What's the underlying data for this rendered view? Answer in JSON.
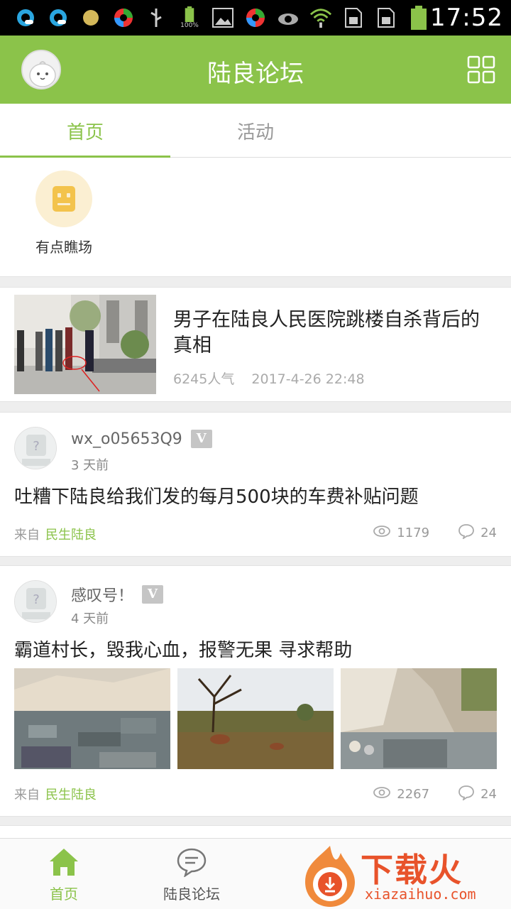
{
  "status_bar": {
    "time": "17:52",
    "battery_label": "100%",
    "icons": [
      "browser-icon",
      "browser-icon",
      "dot-icon",
      "app-icon",
      "usb-icon",
      "battery-icon",
      "image-icon",
      "app-icon",
      "eye-icon",
      "wifi-icon",
      "sim-icon",
      "sim-icon",
      "battery-icon"
    ]
  },
  "header": {
    "title": "陆良论坛",
    "avatar_icon": "avatar-icon",
    "menu_icon": "grid-icon"
  },
  "tabs": [
    {
      "label": "首页",
      "active": true
    },
    {
      "label": "活动",
      "active": false
    }
  ],
  "quick": {
    "items": [
      {
        "label": "有点瞧场",
        "icon": "face-icon"
      }
    ]
  },
  "news": {
    "title": "男子在陆良人民医院跳楼自杀背后的真相",
    "views": "6245人气",
    "date": "2017-4-26 22:48"
  },
  "posts": [
    {
      "user": "wx_o05653Q9",
      "badge": "V",
      "time": "3 天前",
      "title": "吐糟下陆良给我们发的每月500块的车费补贴问题",
      "from_label": "来自",
      "source": "民生陆良",
      "views": "1179",
      "comments": "24"
    },
    {
      "user": "感叹号！",
      "badge": "V",
      "time": "4 天前",
      "title": "霸道村长，毁我心血，报警无果 寻求帮助",
      "from_label": "来自",
      "source": "民生陆良",
      "views": "2267",
      "comments": "24"
    }
  ],
  "bottom_nav": {
    "home_label": "首页",
    "forum_label": "陆良论坛"
  },
  "watermark": {
    "text": "下载火",
    "url": "xiazaihuo.com"
  },
  "colors": {
    "accent": "#8bc34a",
    "badge": "#c5c5c5",
    "watermark": "#e8532b"
  }
}
